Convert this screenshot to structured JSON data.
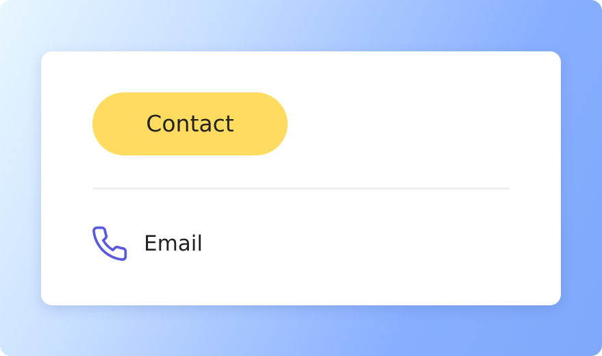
{
  "card": {
    "button_label": "Contact",
    "row": {
      "icon": "phone-icon",
      "label": "Email"
    }
  },
  "colors": {
    "button_bg": "#ffdc60",
    "icon_stroke": "#5a5ae0",
    "text": "#222222"
  }
}
